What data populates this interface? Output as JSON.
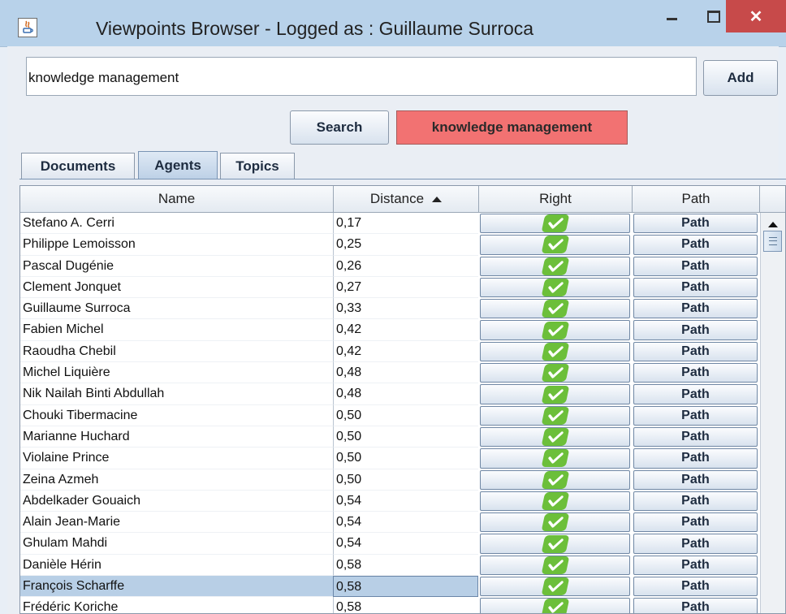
{
  "window": {
    "title": "Viewpoints Browser - Logged as : Guillaume Surroca",
    "app_icon": "java-icon",
    "controls": {
      "minimize_icon": "minimize-icon",
      "maximize_icon": "maximize-icon",
      "close_icon": "close-icon",
      "close_glyph": "✕"
    }
  },
  "search": {
    "value": "knowledge management",
    "add_label": "Add",
    "search_label": "Search",
    "keyword_badge": "knowledge management",
    "badge_color": "#f27272"
  },
  "tabs": [
    {
      "label": "Documents",
      "active": false
    },
    {
      "label": "Agents",
      "active": true
    },
    {
      "label": "Topics",
      "active": false
    }
  ],
  "table": {
    "columns": [
      "Name",
      "Distance",
      "Right",
      "Path"
    ],
    "sort": {
      "column": "Distance",
      "direction": "ascending"
    },
    "path_label": "Path",
    "rows": [
      {
        "name": "Stefano A. Cerri",
        "distance": "0,17"
      },
      {
        "name": "Philippe Lemoisson",
        "distance": "0,25"
      },
      {
        "name": "Pascal Dugénie",
        "distance": "0,26"
      },
      {
        "name": "Clement Jonquet",
        "distance": "0,27"
      },
      {
        "name": "Guillaume Surroca",
        "distance": "0,33"
      },
      {
        "name": "Fabien Michel",
        "distance": "0,42"
      },
      {
        "name": "Raoudha Chebil",
        "distance": "0,42"
      },
      {
        "name": "Michel Liquière",
        "distance": "0,48"
      },
      {
        "name": "Nik Nailah Binti Abdullah",
        "distance": "0,48"
      },
      {
        "name": "Chouki Tibermacine",
        "distance": "0,50"
      },
      {
        "name": "Marianne Huchard",
        "distance": "0,50"
      },
      {
        "name": "Violaine Prince",
        "distance": "0,50"
      },
      {
        "name": "Zeina Azmeh",
        "distance": "0,50"
      },
      {
        "name": "Abdelkader Gouaich",
        "distance": "0,54"
      },
      {
        "name": "Alain Jean-Marie",
        "distance": "0,54"
      },
      {
        "name": "Ghulam Mahdi",
        "distance": "0,54"
      },
      {
        "name": "Danièle Hérin",
        "distance": "0,58"
      },
      {
        "name": "François Scharffe",
        "distance": "0,58",
        "selected": true
      },
      {
        "name": "Frédéric Koriche",
        "distance": "0,58"
      }
    ],
    "right_icon": "check-icon",
    "check_color": "#6cbf3a"
  }
}
